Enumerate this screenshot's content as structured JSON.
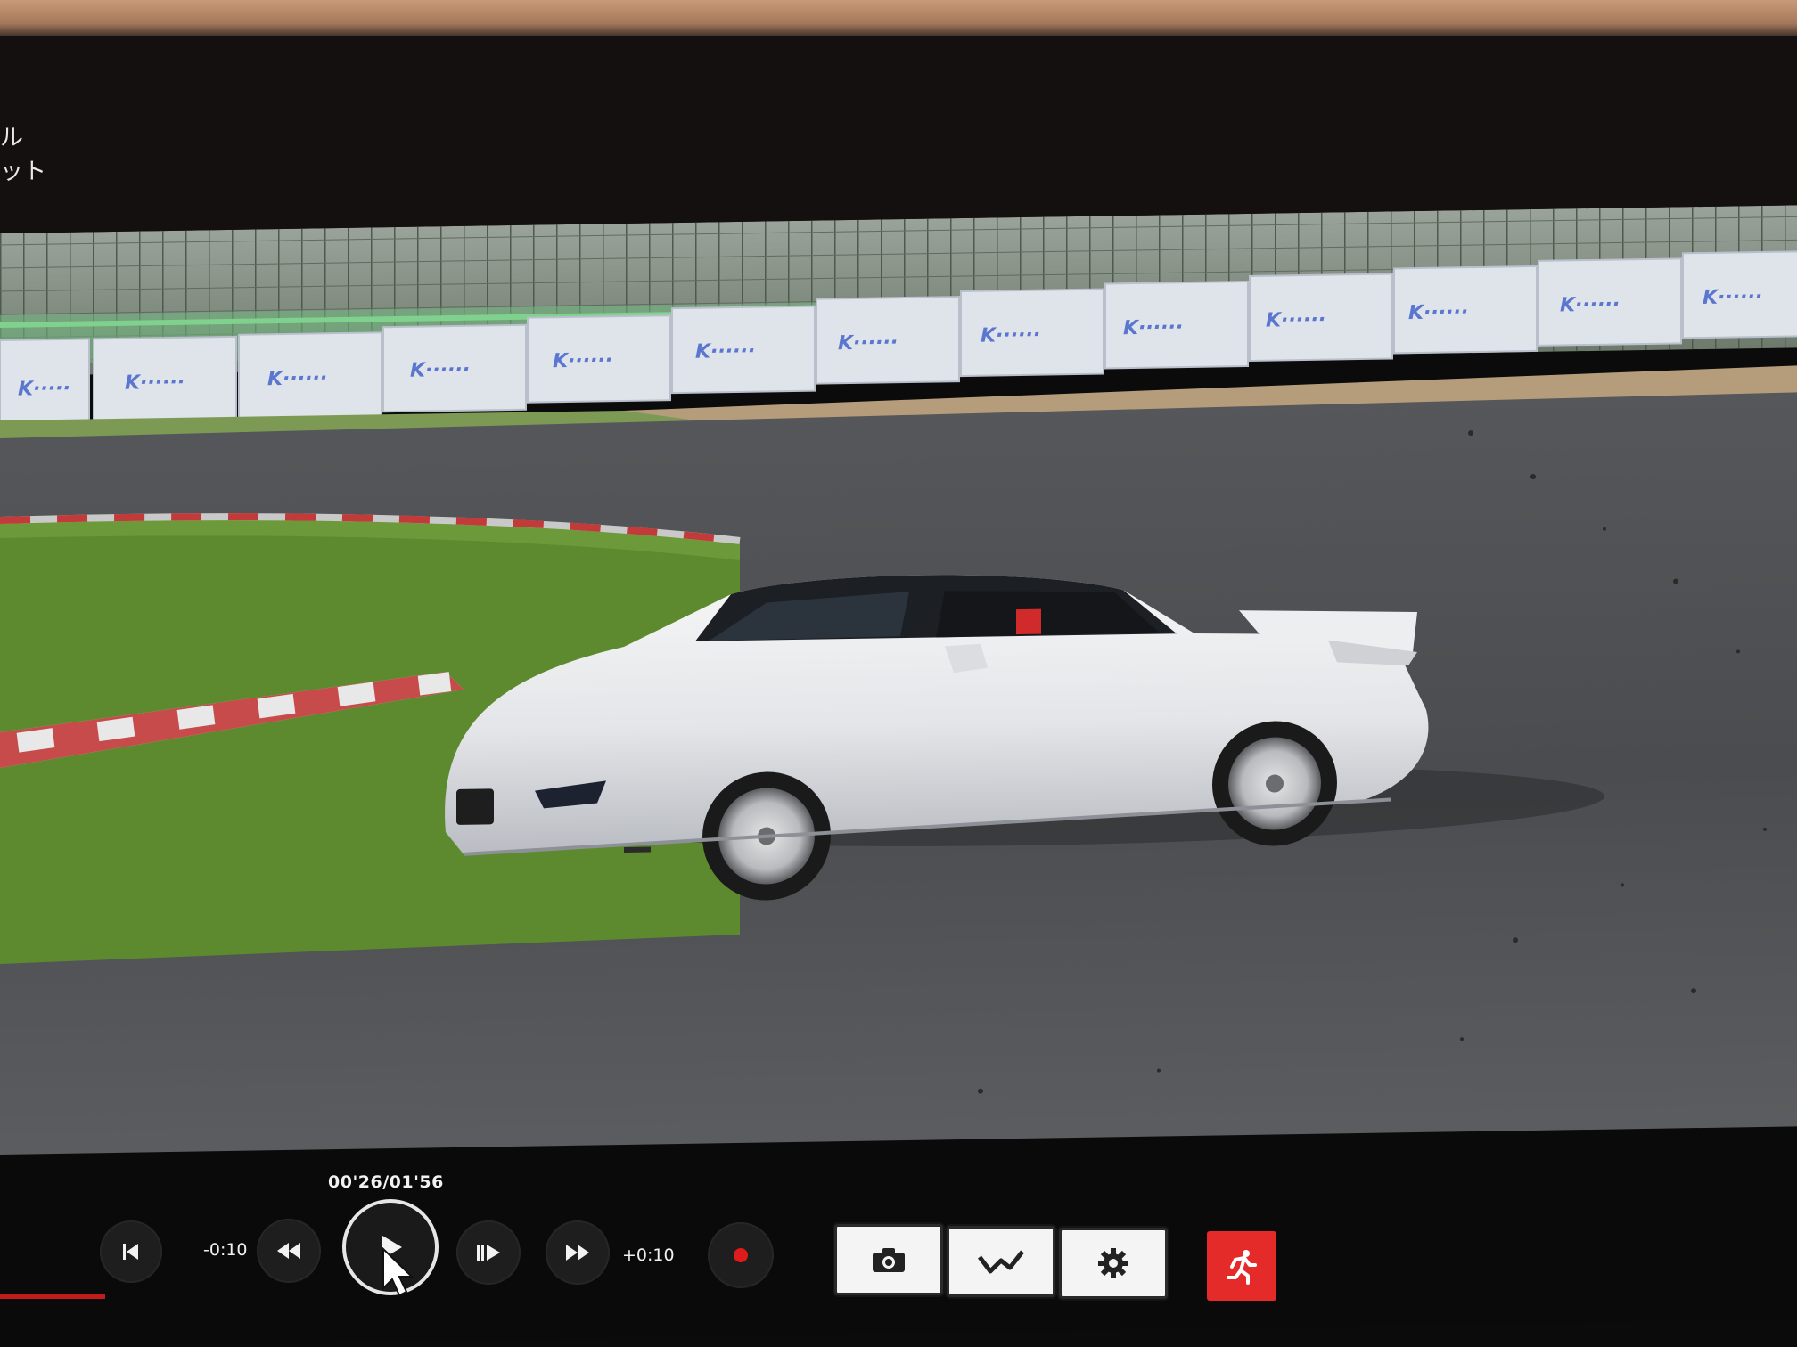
{
  "title_text": {
    "line1": "ル",
    "line2": "ット"
  },
  "replay": {
    "elapsed_time": "00'26/01'56",
    "rewind_step_label": "-0:10",
    "forward_step_label": "+0:10",
    "progress_fraction": 0.22
  },
  "icons": {
    "skip_back": "skip-to-start-icon",
    "rewind": "rewind-icon",
    "play": "play-icon",
    "frame_advance": "frame-advance-icon",
    "fast_forward": "fast-forward-icon",
    "record": "record-icon",
    "camera": "camera-icon",
    "telemetry": "telemetry-graph-icon",
    "settings": "gear-icon",
    "exit": "running-exit-icon"
  },
  "colors": {
    "accent_red": "#e52a2a",
    "record_red": "#e01b1b",
    "button_face": "#f4f4f4"
  }
}
